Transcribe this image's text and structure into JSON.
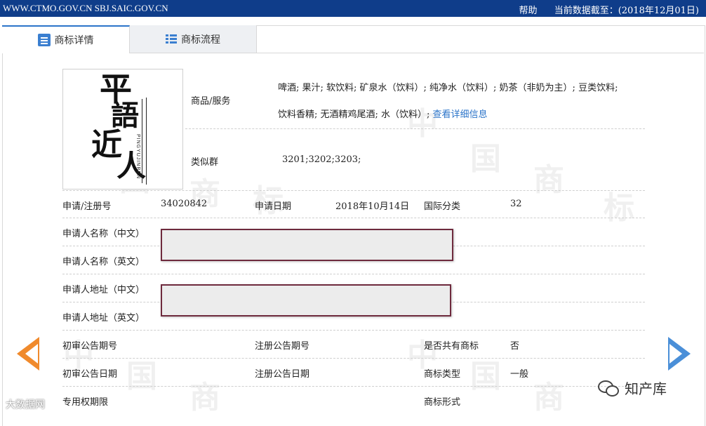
{
  "topbar": {
    "site": "WWW.CTMO.GOV.CN SBJ.SAIC.GOV.CN",
    "help": "帮助",
    "data_date": "当前数据截至：(2018年12月01日)",
    "bg_color": "#0f3d8a"
  },
  "tabs": [
    {
      "label": "商标详情",
      "icon": "document-list-icon",
      "active": true
    },
    {
      "label": "商标流程",
      "icon": "list-icon",
      "active": false
    }
  ],
  "logo_text": {
    "chars": [
      "平",
      "語",
      "近",
      "人"
    ],
    "pinyin": "PINGYUJINREN"
  },
  "goods": {
    "label": "商品/服务",
    "line1": "啤酒; 果汁; 软饮料; 矿泉水（饮料）; 纯净水（饮料）; 奶茶（非奶为主）; 豆类饮料;",
    "line2": "饮料香精; 无酒精鸡尾酒; 水（饮料）;",
    "more_link": "查看详细信息"
  },
  "similar_group": {
    "label": "类似群",
    "value": "3201;3202;3203;"
  },
  "reg_no": {
    "label": "申请/注册号",
    "value": "34020842"
  },
  "apply_date": {
    "label": "申请日期",
    "value": "2018年10月14日"
  },
  "intl_class": {
    "label": "国际分类",
    "value": "32"
  },
  "applicant_cn": {
    "label": "申请人名称（中文）"
  },
  "applicant_en": {
    "label": "申请人名称（英文）"
  },
  "address_cn": {
    "label": "申请人地址（中文）"
  },
  "address_en": {
    "label": "申请人地址（英文）"
  },
  "prelim_pub_no": {
    "label": "初审公告期号"
  },
  "reg_pub_no": {
    "label": "注册公告期号"
  },
  "shared_mark": {
    "label": "是否共有商标",
    "value": "否"
  },
  "prelim_pub_date": {
    "label": "初审公告日期"
  },
  "reg_pub_date": {
    "label": "注册公告日期"
  },
  "mark_type": {
    "label": "商标类型",
    "value": "一般"
  },
  "exclusive_period": {
    "label": "专用权期限"
  },
  "mark_form": {
    "label": "商标形式"
  },
  "brand_watermark": "知产库",
  "corner_watermark": "大数据网",
  "colors": {
    "accent": "#2b74c9",
    "redaction_border": "#6e2a3d",
    "arrow_left": "#f08a2c",
    "arrow_right": "#4a8fd8"
  }
}
